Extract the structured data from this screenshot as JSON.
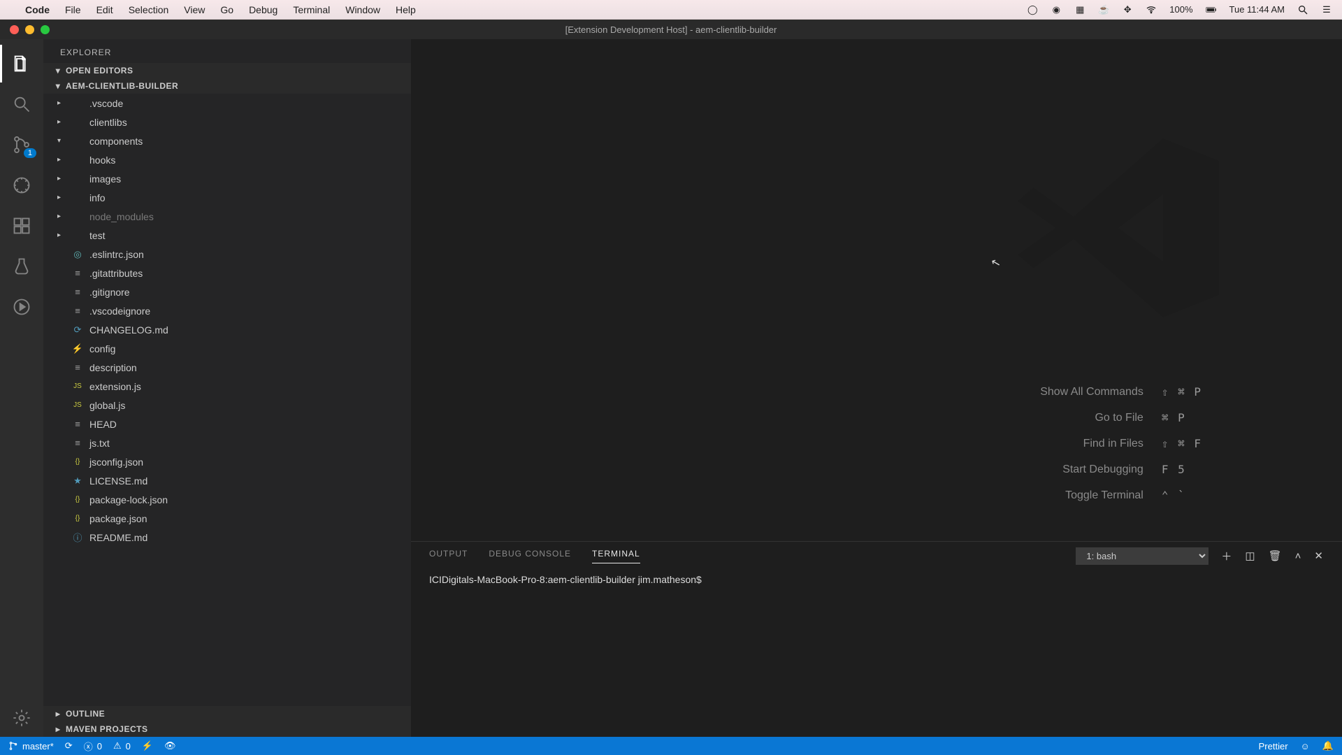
{
  "mac": {
    "app_name": "Code",
    "menus": [
      "File",
      "Edit",
      "Selection",
      "View",
      "Go",
      "Debug",
      "Terminal",
      "Window",
      "Help"
    ],
    "battery": "100%",
    "clock": "Tue 11:44 AM"
  },
  "window_title": "[Extension Development Host] - aem-clientlib-builder",
  "explorer": {
    "title": "EXPLORER",
    "open_editors": "OPEN EDITORS",
    "workspace": "AEM-CLIENTLIB-BUILDER",
    "outline": "OUTLINE",
    "maven": "MAVEN PROJECTS",
    "tree": [
      {
        "name": ".vscode",
        "kind": "folder"
      },
      {
        "name": "clientlibs",
        "kind": "folder"
      },
      {
        "name": "components",
        "kind": "folder",
        "expanded": true
      },
      {
        "name": "hooks",
        "kind": "folder"
      },
      {
        "name": "images",
        "kind": "folder"
      },
      {
        "name": "info",
        "kind": "folder"
      },
      {
        "name": "node_modules",
        "kind": "folder",
        "dim": true
      },
      {
        "name": "test",
        "kind": "folder"
      },
      {
        "name": ".eslintrc.json",
        "kind": "file",
        "iconColor": "teal",
        "iconChar": "◎"
      },
      {
        "name": ".gitattributes",
        "kind": "file",
        "iconColor": "grey",
        "iconChar": "≡"
      },
      {
        "name": ".gitignore",
        "kind": "file",
        "iconColor": "grey",
        "iconChar": "≡"
      },
      {
        "name": ".vscodeignore",
        "kind": "file",
        "iconColor": "grey",
        "iconChar": "≡"
      },
      {
        "name": "CHANGELOG.md",
        "kind": "file",
        "iconColor": "blue",
        "iconChar": "⟳"
      },
      {
        "name": "config",
        "kind": "file",
        "iconColor": "orange",
        "iconChar": "⚡"
      },
      {
        "name": "description",
        "kind": "file",
        "iconColor": "grey",
        "iconChar": "≡"
      },
      {
        "name": "extension.js",
        "kind": "file",
        "iconColor": "yellow",
        "iconChar": "JS"
      },
      {
        "name": "global.js",
        "kind": "file",
        "iconColor": "yellow",
        "iconChar": "JS"
      },
      {
        "name": "HEAD",
        "kind": "file",
        "iconColor": "grey",
        "iconChar": "≡"
      },
      {
        "name": "js.txt",
        "kind": "file",
        "iconColor": "grey",
        "iconChar": "≡"
      },
      {
        "name": "jsconfig.json",
        "kind": "file",
        "iconColor": "yellow",
        "iconChar": "{}"
      },
      {
        "name": "LICENSE.md",
        "kind": "file",
        "iconColor": "blue",
        "iconChar": "★"
      },
      {
        "name": "package-lock.json",
        "kind": "file",
        "iconColor": "yellow",
        "iconChar": "{}"
      },
      {
        "name": "package.json",
        "kind": "file",
        "iconColor": "yellow",
        "iconChar": "{}"
      },
      {
        "name": "README.md",
        "kind": "file",
        "iconColor": "blue",
        "iconChar": "ⓘ"
      }
    ]
  },
  "activity_badge": "1",
  "welcome_shortcuts": [
    {
      "label": "Show All Commands",
      "keys": "⇧ ⌘ P"
    },
    {
      "label": "Go to File",
      "keys": "⌘ P"
    },
    {
      "label": "Find in Files",
      "keys": "⇧ ⌘ F"
    },
    {
      "label": "Start Debugging",
      "keys": "F 5"
    },
    {
      "label": "Toggle Terminal",
      "keys": "⌃ `"
    }
  ],
  "panel": {
    "tabs": {
      "output": "OUTPUT",
      "debug": "DEBUG CONSOLE",
      "terminal": "TERMINAL"
    },
    "shell": "1: bash",
    "prompt": "ICIDigitals-MacBook-Pro-8:aem-clientlib-builder jim.matheson$"
  },
  "statusbar": {
    "branch": "master*",
    "errors": "0",
    "warnings": "0",
    "prettier": "Prettier"
  }
}
